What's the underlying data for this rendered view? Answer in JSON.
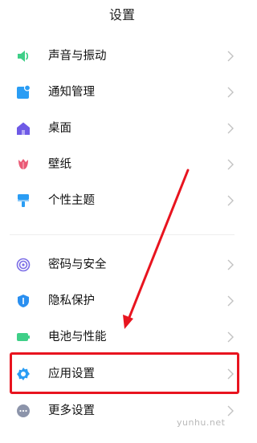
{
  "header": {
    "title": "设置"
  },
  "items": [
    {
      "label": "声音与振动",
      "icon": "speaker-icon",
      "color": "#3fcf88"
    },
    {
      "label": "通知管理",
      "icon": "notification-icon",
      "color": "#2a9df4"
    },
    {
      "label": "桌面",
      "icon": "home-icon",
      "color": "#6e5ae6"
    },
    {
      "label": "壁纸",
      "icon": "tulip-icon",
      "color": "#ea5a76"
    },
    {
      "label": "个性主题",
      "icon": "brush-icon",
      "color": "#2a9df4"
    },
    {
      "label": "密码与安全",
      "icon": "fingerprint-icon",
      "color": "#7c6ee6"
    },
    {
      "label": "隐私保护",
      "icon": "shield-icon",
      "color": "#2a8ff0"
    },
    {
      "label": "电池与性能",
      "icon": "battery-icon",
      "color": "#3fcf88"
    },
    {
      "label": "应用设置",
      "icon": "gear-icon",
      "color": "#2a9df4"
    },
    {
      "label": "更多设置",
      "icon": "more-icon",
      "color": "#8c94aa"
    }
  ],
  "annotation": {
    "highlight_color": "#e8141f",
    "highlighted_item": "应用设置"
  },
  "watermark": {
    "text": "yunhu.net"
  }
}
